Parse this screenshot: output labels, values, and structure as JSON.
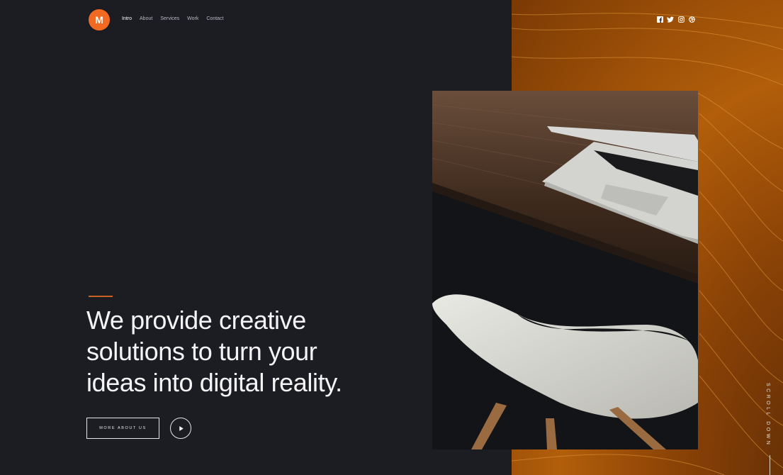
{
  "brand": {
    "logo_letter": "M",
    "accent_color": "#f26a22"
  },
  "nav": {
    "items": [
      {
        "label": "Intro",
        "active": true
      },
      {
        "label": "About",
        "active": false
      },
      {
        "label": "Services",
        "active": false
      },
      {
        "label": "Work",
        "active": false
      },
      {
        "label": "Contact",
        "active": false
      }
    ]
  },
  "social": {
    "icons": [
      "facebook-icon",
      "twitter-icon",
      "instagram-icon",
      "dribbble-icon"
    ]
  },
  "hero": {
    "headline_lines": [
      "We provide creative",
      "solutions to turn your",
      "ideas into digital reality."
    ],
    "more_button_label": "MORE ABOUT US",
    "play_icon": "play-icon",
    "image": "laptop-on-desk-with-white-chair-photo"
  },
  "scroll": {
    "label": "SCROLL DOWN"
  },
  "colors": {
    "background": "#1c1c23",
    "right_panel": "#a5560a",
    "accent_line": "#c8641e"
  }
}
